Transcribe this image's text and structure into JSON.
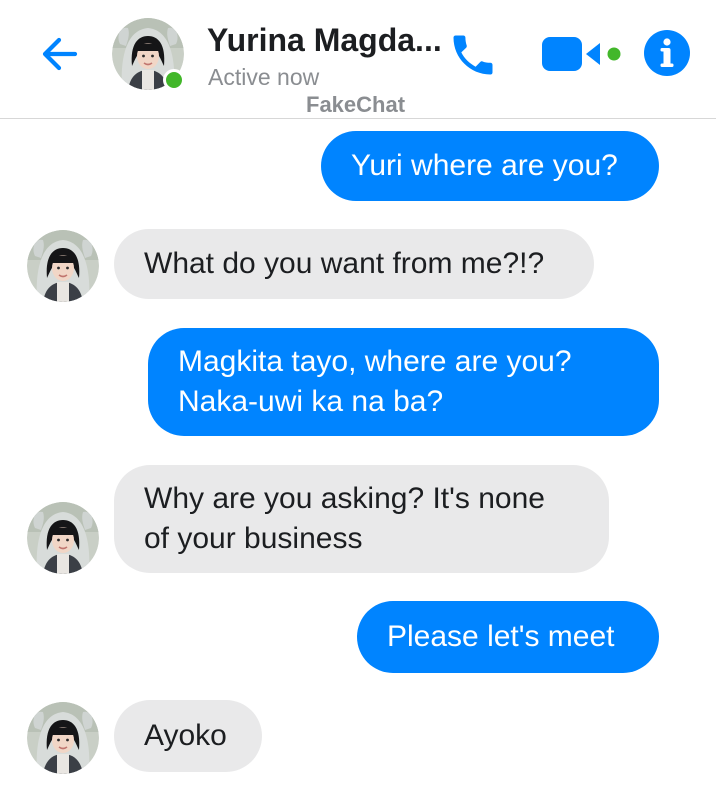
{
  "header": {
    "back_icon": "arrow-left-icon",
    "contact_name": "Yurina Magda...",
    "status": "Active now",
    "watermark": "FakeChat",
    "icons": [
      "phone-icon",
      "video-camera-icon",
      "info-icon"
    ],
    "accent_color": "#0084ff",
    "active_color": "#42b72a"
  },
  "messages": [
    {
      "direction": "sent",
      "lines": [
        "Yuri where are you?"
      ]
    },
    {
      "direction": "received",
      "lines": [
        "What do you want from me?!?"
      ]
    },
    {
      "direction": "sent",
      "lines": [
        "Magkita tayo, where are you?",
        "Naka-uwi ka na ba?"
      ]
    },
    {
      "direction": "received",
      "lines": [
        "Why are you asking? It's none",
        "of your business"
      ]
    },
    {
      "direction": "sent",
      "lines": [
        "Please let's meet"
      ]
    },
    {
      "direction": "received",
      "lines": [
        "Ayoko"
      ]
    }
  ],
  "colors": {
    "sent_bubble": "#0084ff",
    "received_bubble": "#e9e9ea",
    "divider": "#d7d7d7",
    "muted_text": "#8a8d91"
  }
}
